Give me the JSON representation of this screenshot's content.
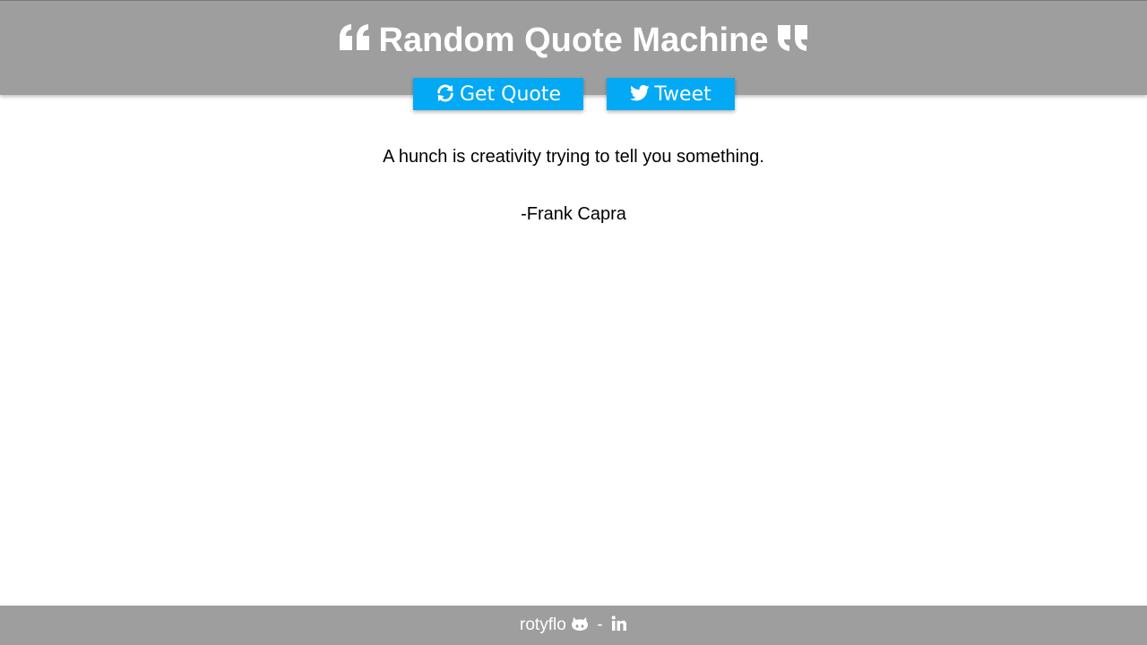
{
  "header": {
    "title": "Random Quote Machine",
    "left_icon": "quote-left-icon",
    "right_icon": "quote-right-icon",
    "background": "#9e9e9e"
  },
  "buttons": {
    "get_quote_label": "Get Quote",
    "get_quote_icon": "refresh-icon",
    "tweet_label": "Tweet",
    "tweet_icon": "twitter-icon",
    "color": "#03a9f4"
  },
  "quote": {
    "text": "A hunch is creativity trying to tell you something.",
    "author": "-Frank Capra"
  },
  "footer": {
    "author_name": "rotyflo",
    "separator": "-",
    "github_icon": "github-icon",
    "linkedin_icon": "linkedin-icon",
    "background": "#9e9e9e"
  }
}
